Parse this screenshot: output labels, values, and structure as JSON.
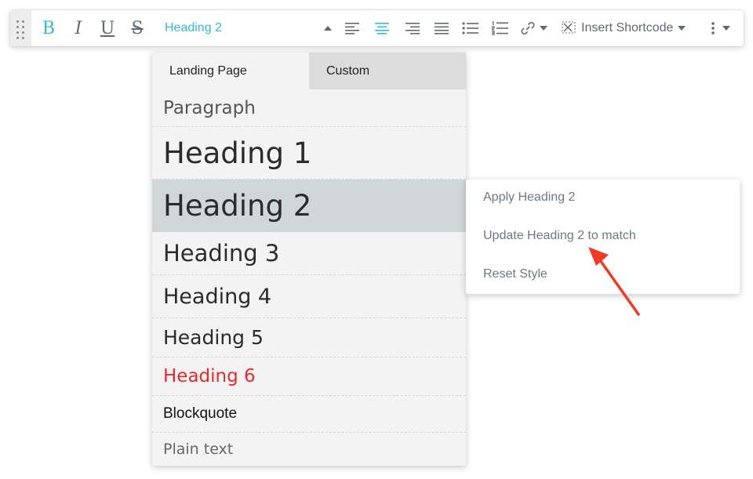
{
  "toolbar": {
    "style_select_label": "Heading 2",
    "shortcode_label": "Insert Shortcode",
    "buttons": {
      "bold": "B",
      "italic": "I",
      "underline": "U",
      "strikethrough": "S"
    },
    "accent_color": "#34b8d6"
  },
  "dropdown": {
    "tabs": [
      "Landing Page",
      "Custom"
    ],
    "items": [
      {
        "label": "Paragraph"
      },
      {
        "label": "Heading 1"
      },
      {
        "label": "Heading 2",
        "selected": true
      },
      {
        "label": "Heading 3"
      },
      {
        "label": "Heading 4"
      },
      {
        "label": "Heading 5"
      },
      {
        "label": "Heading 6",
        "color": "#e8282b"
      },
      {
        "label": "Blockquote"
      },
      {
        "label": "Plain text"
      }
    ]
  },
  "context_menu": {
    "items": [
      "Apply Heading 2",
      "Update Heading 2 to match",
      "Reset Style"
    ]
  },
  "annotation_arrow_color": "#f03a24"
}
